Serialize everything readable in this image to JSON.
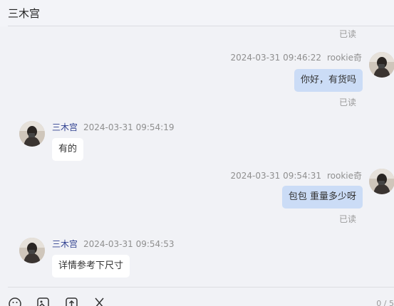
{
  "header": {
    "title": "三木宫"
  },
  "read_label": "已读",
  "messages": {
    "m1": {
      "name": "rookie奇",
      "time": "2024-03-31 09:46:22",
      "text": "你好，有货吗"
    },
    "m2": {
      "name": "三木宫",
      "time": "2024-03-31 09:54:19",
      "text": "有的"
    },
    "m3": {
      "name": "rookie奇",
      "time": "2024-03-31 09:54:31",
      "text": "包包 重量多少呀"
    },
    "m4": {
      "name": "三木宫",
      "time": "2024-03-31 09:54:53",
      "text": "详情参考下尺寸"
    }
  },
  "toolbar": {
    "icons": [
      "emoji-icon",
      "image-icon",
      "upload-icon",
      "scissors-icon"
    ],
    "counter": "0 / 5"
  },
  "colors": {
    "my_bubble": "#cbdcf6",
    "their_bubble": "#ffffff",
    "seller_name": "#2e3f8f",
    "background": "#f1f2f6"
  }
}
